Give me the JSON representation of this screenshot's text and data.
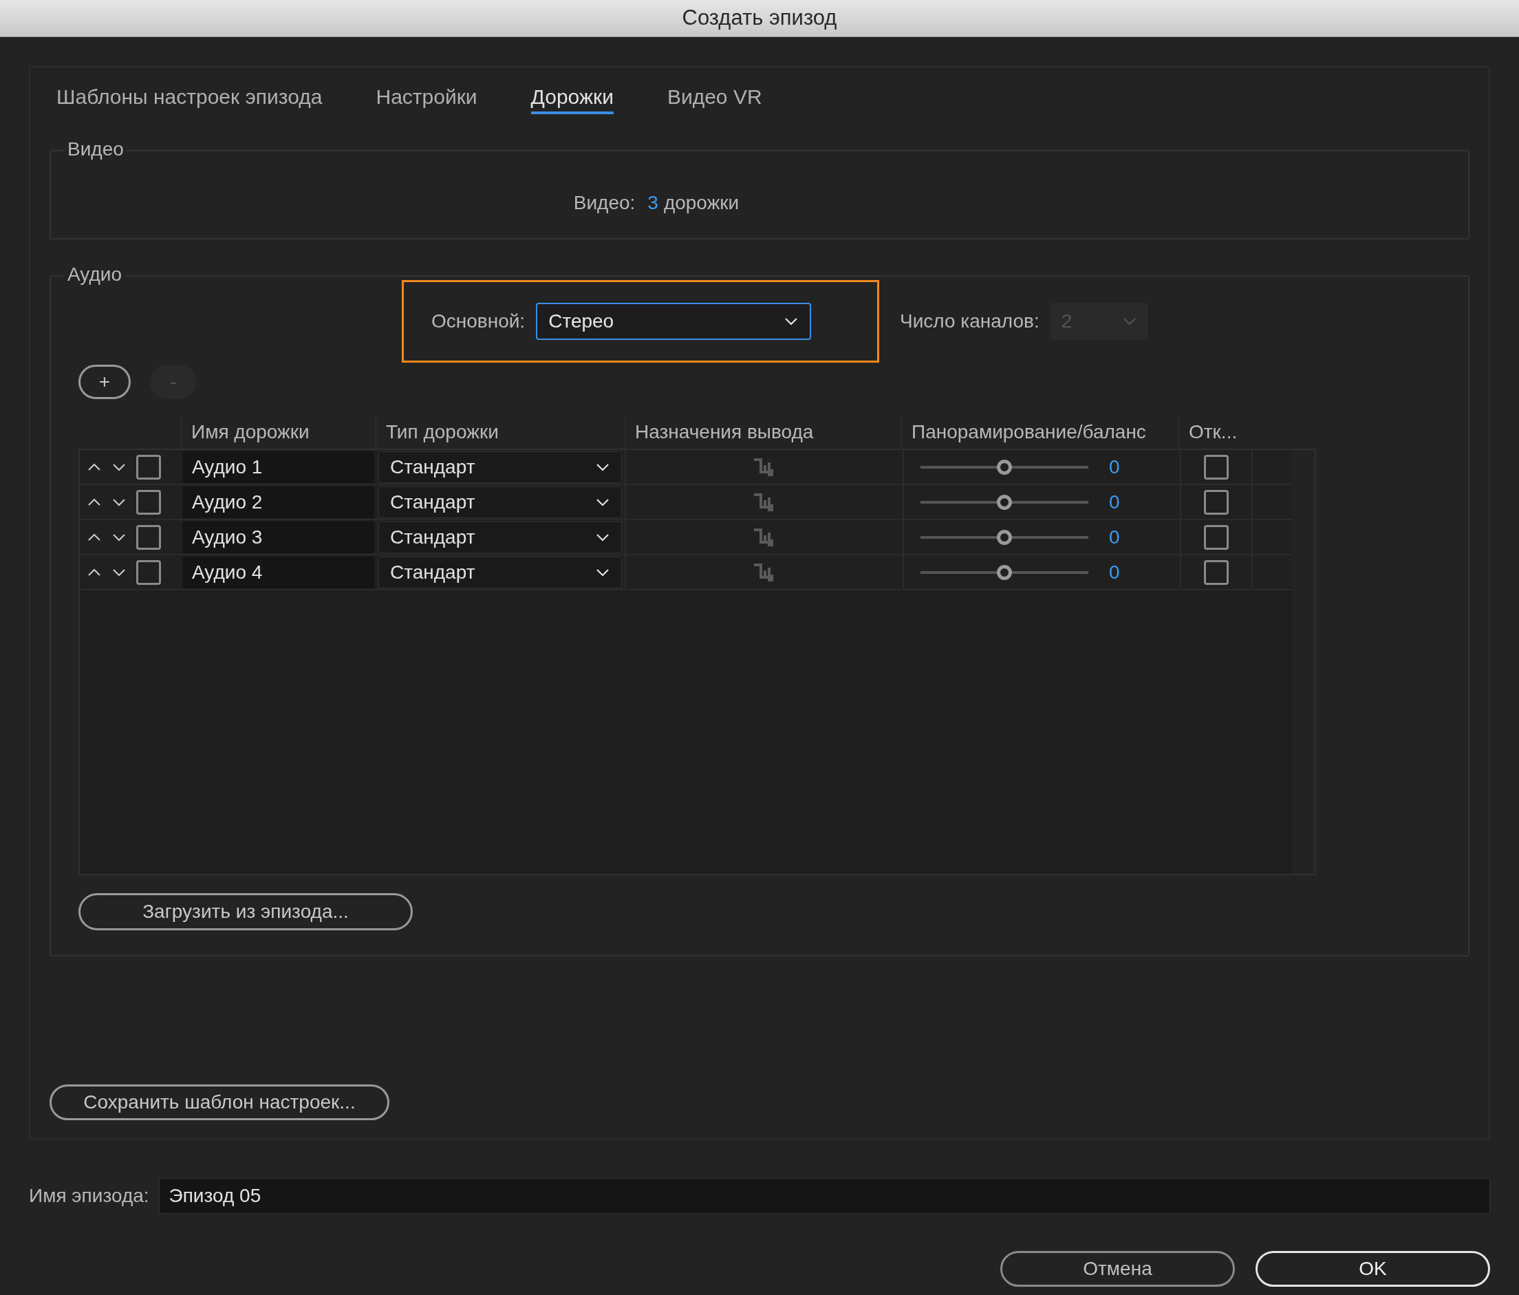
{
  "window": {
    "title": "Создать эпизод"
  },
  "tabs": [
    {
      "label": "Шаблоны настроек эпизода",
      "selected": false
    },
    {
      "label": "Настройки",
      "selected": false
    },
    {
      "label": "Дорожки",
      "selected": true
    },
    {
      "label": "Видео VR",
      "selected": false
    }
  ],
  "video": {
    "legend": "Видео",
    "label": "Видео:",
    "count": "3",
    "unit": "дорожки"
  },
  "audio": {
    "legend": "Аудио",
    "master": {
      "label": "Основной:",
      "value": "Стерео",
      "highlighted": true
    },
    "channels": {
      "label": "Число каналов:",
      "value": "2",
      "disabled": true
    },
    "add_button": {
      "label": "+",
      "disabled": false
    },
    "remove_button": {
      "label": "-",
      "disabled": true
    },
    "columns": [
      "Имя дорожки",
      "Тип дорожки",
      "Назначения вывода",
      "Панорамирование/баланс",
      "Отк..."
    ],
    "tracks": [
      {
        "checked": false,
        "name": "Аудио 1",
        "type": "Стандарт",
        "level": 0.5,
        "reading": "0",
        "open": false
      },
      {
        "checked": false,
        "name": "Аудио 2",
        "type": "Стандарт",
        "level": 0.5,
        "reading": "0",
        "open": false
      },
      {
        "checked": false,
        "name": "Аудио 3",
        "type": "Стандарт",
        "level": 0.5,
        "reading": "0",
        "open": false
      },
      {
        "checked": false,
        "name": "Аудио 4",
        "type": "Стандарт",
        "level": 0.5,
        "reading": "0",
        "open": false
      }
    ],
    "load_button": "Загрузить из эпизода..."
  },
  "save_button": "Сохранить шаблон настроек...",
  "episode_name": {
    "label": "Имя эпизода:",
    "value": "Эпизод 05"
  },
  "buttons": [
    {
      "label": "Отмена",
      "kind": "secondary"
    },
    {
      "label": "OK",
      "kind": "primary"
    }
  ]
}
